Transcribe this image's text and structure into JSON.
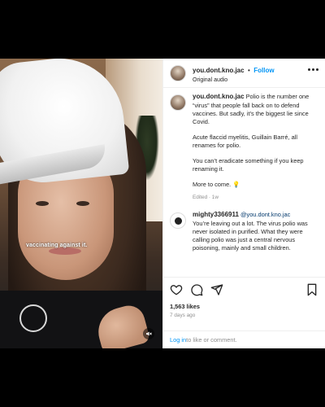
{
  "header": {
    "username": "you.dont.kno.jac",
    "separator": "•",
    "follow_label": "Follow",
    "audio_label": "Original audio"
  },
  "media": {
    "caption_overlay": "vaccinating against it."
  },
  "caption": {
    "username": "you.dont.kno.jac",
    "paragraph1": "Polio is the number one “virus” that people fall back on to defend vaccines. But sadly, it’s the biggest lie since Covid.",
    "paragraph2": "Acute flaccid myelitis, Guillain Barré, all renames for polio.",
    "paragraph3": "You can’t eradicate something if you keep renaming it.",
    "paragraph4": "More to come. 💡",
    "meta": "Edited · 1w"
  },
  "reply": {
    "username": "mighty3366911",
    "mention": "@you.dont.kno.jac",
    "text": "You’re leaving out a lot. The virus polio was never isolated in purified. What they were calling polio was just a central nervous poisoning, mainly and small children."
  },
  "actions": {
    "likes": "1,563 likes",
    "time": "7 days ago"
  },
  "footer": {
    "login_link": "Log in",
    "login_text": " to like or comment."
  },
  "icons": [
    "more-icon",
    "heart-icon",
    "comment-icon",
    "share-icon",
    "bookmark-icon",
    "mute-icon"
  ],
  "colors": {
    "link_blue": "#0095f6",
    "mention_blue": "#00376b",
    "text": "#262626",
    "muted": "#8e8e8e"
  }
}
